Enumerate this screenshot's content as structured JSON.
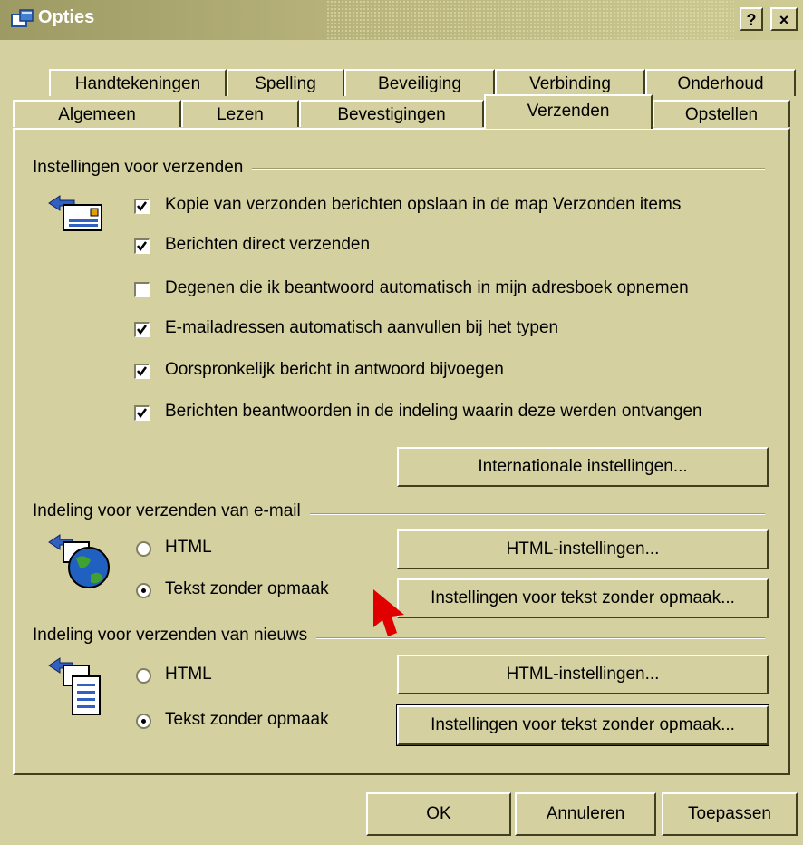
{
  "window": {
    "title": "Opties",
    "help_label": "?",
    "close_label": "×"
  },
  "tabs_row1": [
    "Handtekeningen",
    "Spelling",
    "Beveiliging",
    "Verbinding",
    "Onderhoud"
  ],
  "tabs_row2": [
    "Algemeen",
    "Lezen",
    "Bevestigingen",
    "Verzenden",
    "Opstellen"
  ],
  "selected_tab": "Verzenden",
  "send_settings": {
    "heading": "Instellingen voor verzenden",
    "options": [
      {
        "label": "Kopie van verzonden berichten opslaan in de map Verzonden items",
        "checked": true
      },
      {
        "label": "Berichten direct verzenden",
        "checked": true
      },
      {
        "label": "Degenen die ik beantwoord automatisch in mijn adresboek opnemen",
        "checked": false
      },
      {
        "label": "E-mailadressen automatisch aanvullen bij het typen",
        "checked": true
      },
      {
        "label": "Oorspronkelijk bericht in antwoord bijvoegen",
        "checked": true
      },
      {
        "label": "Berichten beantwoorden in de indeling waarin deze werden ontvangen",
        "checked": true
      }
    ],
    "intl_button": "Internationale instellingen..."
  },
  "mail_format": {
    "heading": "Indeling voor verzenden van e-mail",
    "radio_html": "HTML",
    "radio_text": "Tekst zonder opmaak",
    "selected": "Tekst zonder opmaak",
    "html_button": "HTML-instellingen...",
    "text_button": "Instellingen voor tekst zonder opmaak..."
  },
  "news_format": {
    "heading": "Indeling voor verzenden van nieuws",
    "radio_html": "HTML",
    "radio_text": "Tekst zonder opmaak",
    "selected": "Tekst zonder opmaak",
    "html_button": "HTML-instellingen...",
    "text_button": "Instellingen voor tekst zonder opmaak..."
  },
  "footer": {
    "ok": "OK",
    "cancel": "Annuleren",
    "apply": "Toepassen"
  },
  "colors": {
    "face": "#d4d0a0",
    "pointer": "#e00000"
  }
}
